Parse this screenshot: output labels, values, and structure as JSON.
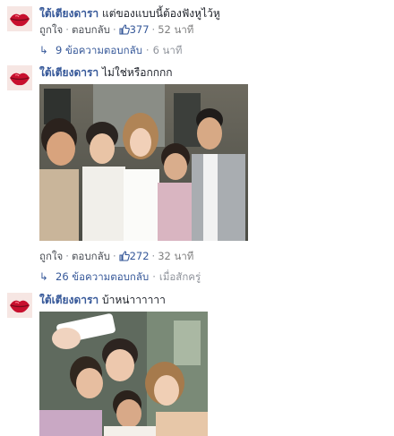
{
  "comments": [
    {
      "author": "ใต้เตียงดารา",
      "text": "แต่ของแบบนี้ต้องฟังหูไว้หู",
      "like_label": "ถูกใจ",
      "reply_label": "ตอบกลับ",
      "like_count": "377",
      "time": "52 นาที",
      "replies_text": "9 ข้อความตอบกลับ",
      "replies_time": "6 นาที"
    },
    {
      "author": "ใต้เตียงดารา",
      "text": "ไม่ใช่หรือกกกก",
      "like_label": "ถูกใจ",
      "reply_label": "ตอบกลับ",
      "like_count": "272",
      "time": "32 นาที",
      "replies_text": "26 ข้อความตอบกลับ",
      "replies_time": "เมื่อสักครู่"
    },
    {
      "author": "ใต้เตียงดารา",
      "text": "บ้าหน่าาาาาา"
    }
  ],
  "icons": {
    "avatar": "lips-icon",
    "like": "thumbs-up-icon",
    "reply_arrow": "reply-arrow-icon"
  },
  "colors": {
    "link": "#365899",
    "meta": "#90949c",
    "lips": "#c8102e"
  }
}
